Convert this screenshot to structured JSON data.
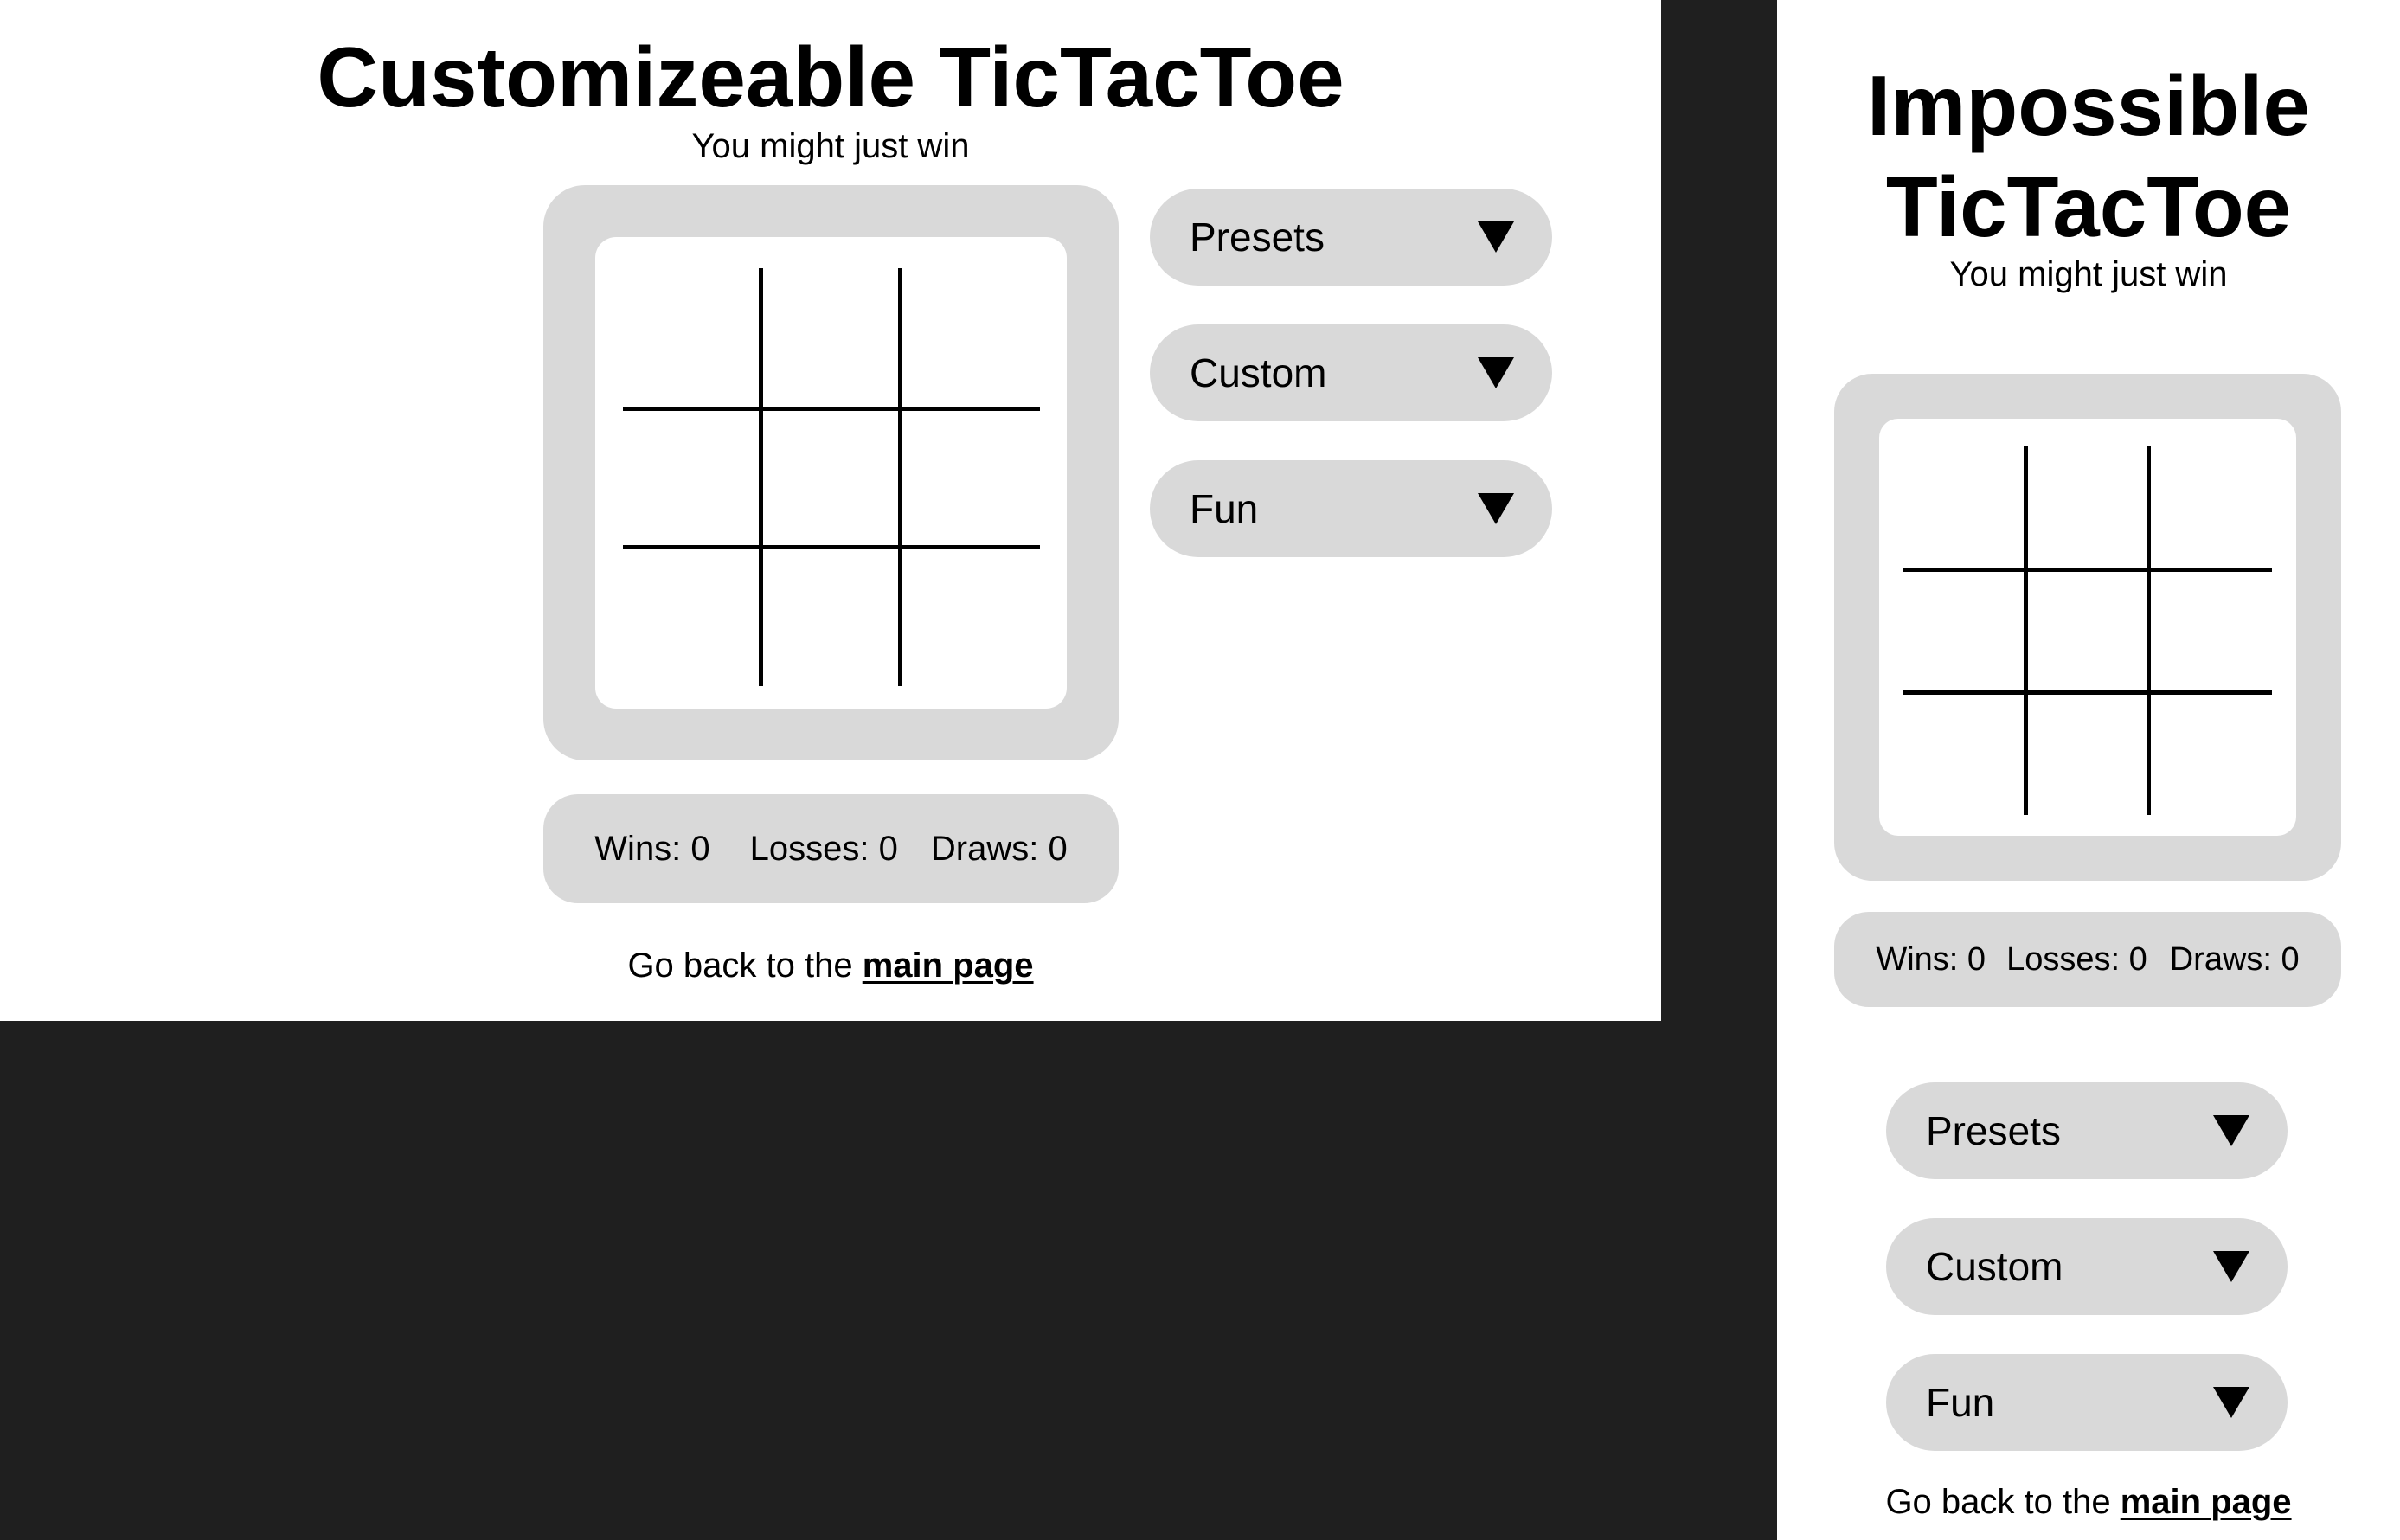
{
  "desktop": {
    "title": "Customizeable TicTacToe",
    "subtitle": "You might just win",
    "stats": {
      "wins": "Wins: 0",
      "losses": "Losses: 0",
      "draws": "Draws: 0"
    },
    "dropdowns": [
      {
        "label": "Presets"
      },
      {
        "label": "Custom"
      },
      {
        "label": "Fun"
      }
    ],
    "footer": {
      "text": "Go back to the ",
      "link": "main page"
    }
  },
  "mobile": {
    "title_line1": "Impossible",
    "title_line2": "TicTacToe",
    "subtitle": "You might just win",
    "stats": {
      "wins": "Wins: 0",
      "losses": "Losses: 0",
      "draws": "Draws: 0"
    },
    "dropdowns": [
      {
        "label": "Presets"
      },
      {
        "label": "Custom"
      },
      {
        "label": "Fun"
      }
    ],
    "footer": {
      "text": "Go back to the ",
      "link": "main page"
    }
  },
  "colors": {
    "background": "#1f1f1f",
    "panel": "#ffffff",
    "control": "#d9d9d9",
    "ink": "#000000"
  }
}
